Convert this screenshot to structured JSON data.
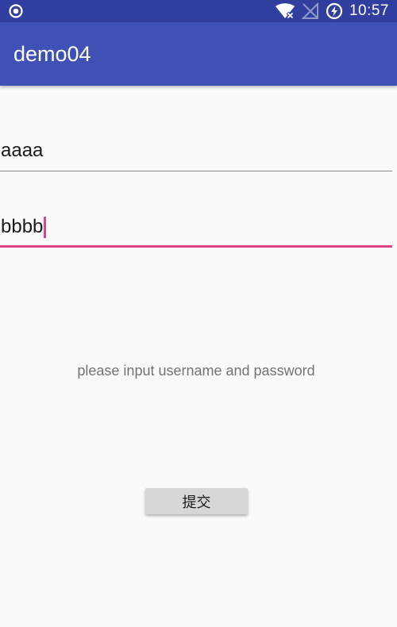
{
  "status_bar": {
    "time": "10:57",
    "icons": [
      "notification-circle-icon",
      "wifi-off-icon",
      "no-signal-icon",
      "battery-charging-icon"
    ]
  },
  "app_bar": {
    "title": "demo04"
  },
  "form": {
    "username_value": "aaaa",
    "password_value": "bbbb",
    "hint": "please input username and password",
    "submit_label": "提交"
  },
  "colors": {
    "status_bar": "#303f9f",
    "primary": "#3f51b5",
    "accent": "#e0458a",
    "background": "#fafafa",
    "button": "#d6d7d7"
  }
}
